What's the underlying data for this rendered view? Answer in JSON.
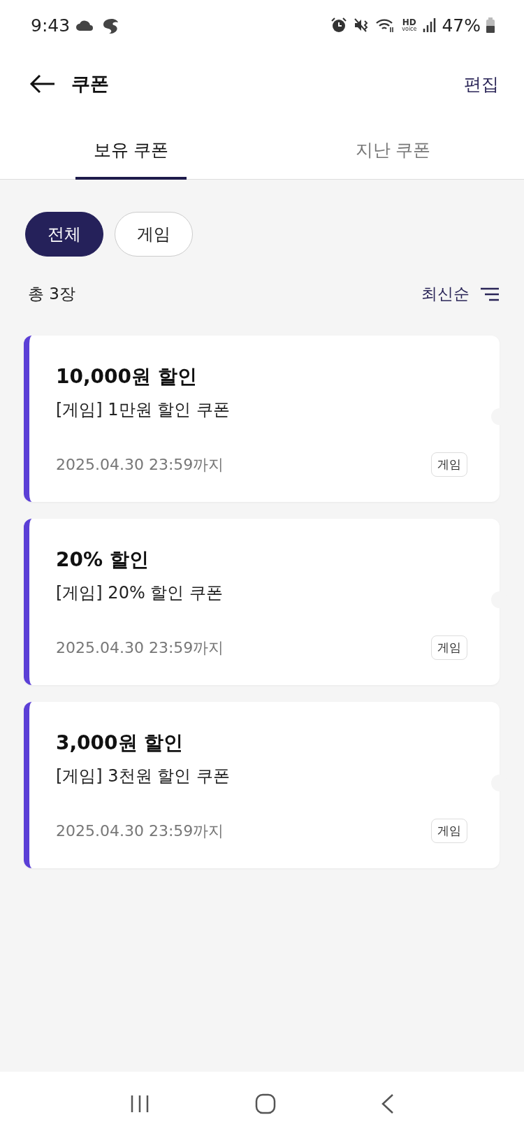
{
  "status_bar": {
    "time": "9:43",
    "hd": "HD",
    "voice": "voice",
    "battery": "47%"
  },
  "header": {
    "title": "쿠폰",
    "action": "편집"
  },
  "tabs": [
    {
      "label": "보유 쿠폰",
      "selected": true
    },
    {
      "label": "지난 쿠폰",
      "selected": false
    }
  ],
  "filters": [
    {
      "label": "전체",
      "selected": true
    },
    {
      "label": "게임",
      "selected": false
    }
  ],
  "count": "총 3장",
  "sort": {
    "label": "최신순"
  },
  "coupons": [
    {
      "title": "10,000원 할인",
      "name": "[게임] 1만원 할인 쿠폰",
      "expiry": "2025.04.30 23:59까지",
      "tag": "게임",
      "color": "#5b3fd6"
    },
    {
      "title": "20% 할인",
      "name": "[게임] 20% 할인 쿠폰",
      "expiry": "2025.04.30 23:59까지",
      "tag": "게임",
      "color": "#5b3fd6"
    },
    {
      "title": "3,000원 할인",
      "name": "[게임] 3천원 할인 쿠폰",
      "expiry": "2025.04.30 23:59까지",
      "tag": "게임",
      "color": "#5b3fd6"
    }
  ]
}
